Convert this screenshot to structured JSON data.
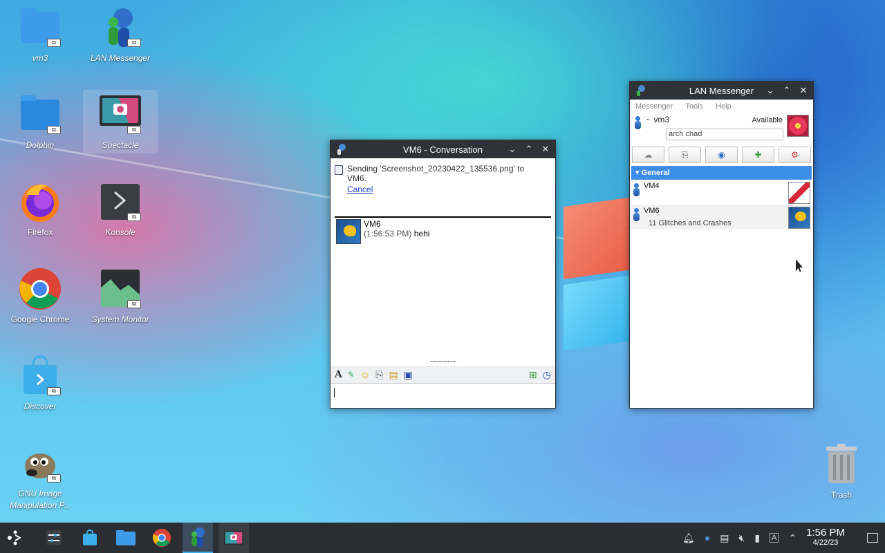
{
  "desktop": {
    "icons": [
      {
        "label": "vm3"
      },
      {
        "label": "LAN Messenger"
      },
      {
        "label": "Dolphin"
      },
      {
        "label": "Spectacle"
      },
      {
        "label": "Firefox"
      },
      {
        "label": "Konsole"
      },
      {
        "label": "Google Chrome"
      },
      {
        "label": "System Monitor"
      },
      {
        "label": "Discover"
      },
      {
        "label": "GNU Image Manipulation P..."
      },
      {
        "label": "Trash"
      }
    ]
  },
  "conversation": {
    "title": "VM6 - Conversation",
    "notice_text": "Sending 'Screenshot_20230422_135536.png' to VM6.",
    "cancel_label": "Cancel",
    "message": {
      "sender": "VM6",
      "time": "(1:56:53 PM)",
      "text": "hehi"
    },
    "splitter_grip": "\"\"\"\"\"\"\"\"\"\"\"\"\"\"\"\"\"\"\"\""
  },
  "messenger": {
    "title": "LAN Messenger",
    "menu": [
      "Messenger",
      "Tools",
      "Help"
    ],
    "user": {
      "name": "vm3",
      "status": "Available",
      "note": "arch chad"
    },
    "group": "General",
    "contacts": [
      {
        "name": "VM4",
        "note": ""
      },
      {
        "name": "VM6",
        "note": "11 Glitches and Crashes"
      }
    ]
  },
  "taskbar": {
    "clock_time": "1:56 PM",
    "clock_date": "4/22/23"
  },
  "colors": {
    "accent": "#3daee9",
    "titlebar": "#2f3338",
    "group_header": "#3d8ee8",
    "link": "#1a3fd9"
  }
}
